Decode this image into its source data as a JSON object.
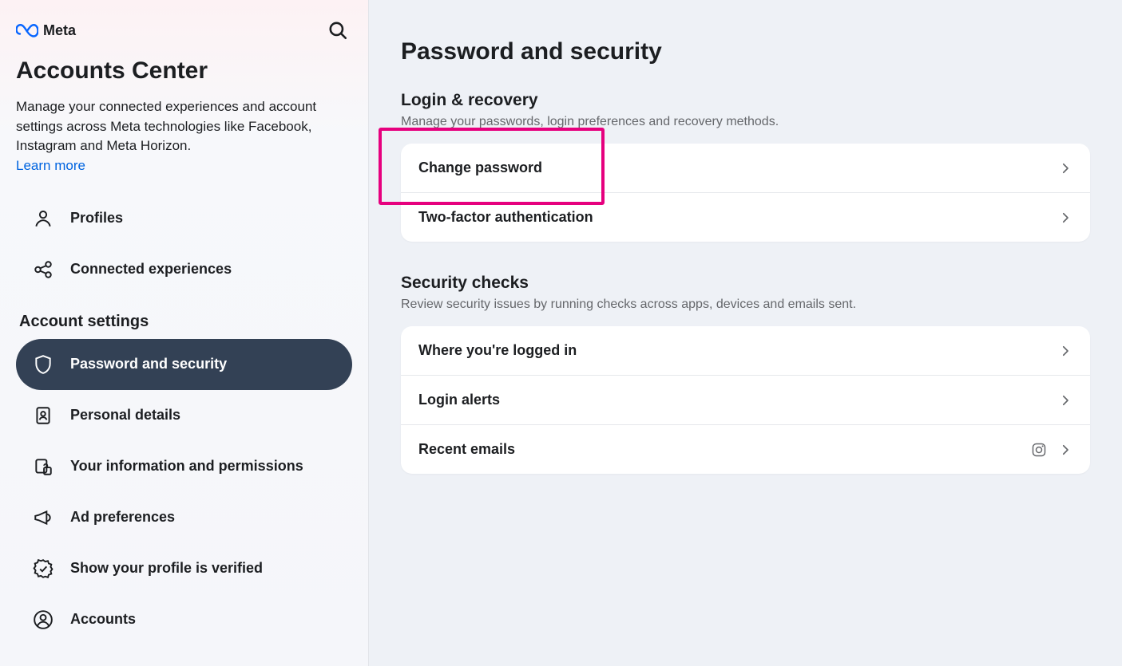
{
  "brand": "Meta",
  "sidebar": {
    "title": "Accounts Center",
    "description": "Manage your connected experiences and account settings across Meta technologies like Facebook, Instagram and Meta Horizon.",
    "learn_more": "Learn more",
    "top_items": [
      {
        "label": "Profiles"
      },
      {
        "label": "Connected experiences"
      }
    ],
    "section_heading": "Account settings",
    "settings_items": [
      {
        "label": "Password and security",
        "active": true
      },
      {
        "label": "Personal details"
      },
      {
        "label": "Your information and permissions"
      },
      {
        "label": "Ad preferences"
      },
      {
        "label": "Show your profile is verified"
      },
      {
        "label": "Accounts"
      }
    ]
  },
  "main": {
    "title": "Password and security",
    "groups": [
      {
        "title": "Login & recovery",
        "desc": "Manage your passwords, login preferences and recovery methods.",
        "items": [
          {
            "label": "Change password",
            "highlighted": true
          },
          {
            "label": "Two-factor authentication"
          }
        ]
      },
      {
        "title": "Security checks",
        "desc": "Review security issues by running checks across apps, devices and emails sent.",
        "items": [
          {
            "label": "Where you're logged in"
          },
          {
            "label": "Login alerts"
          },
          {
            "label": "Recent emails",
            "badge": "instagram"
          }
        ]
      }
    ]
  }
}
